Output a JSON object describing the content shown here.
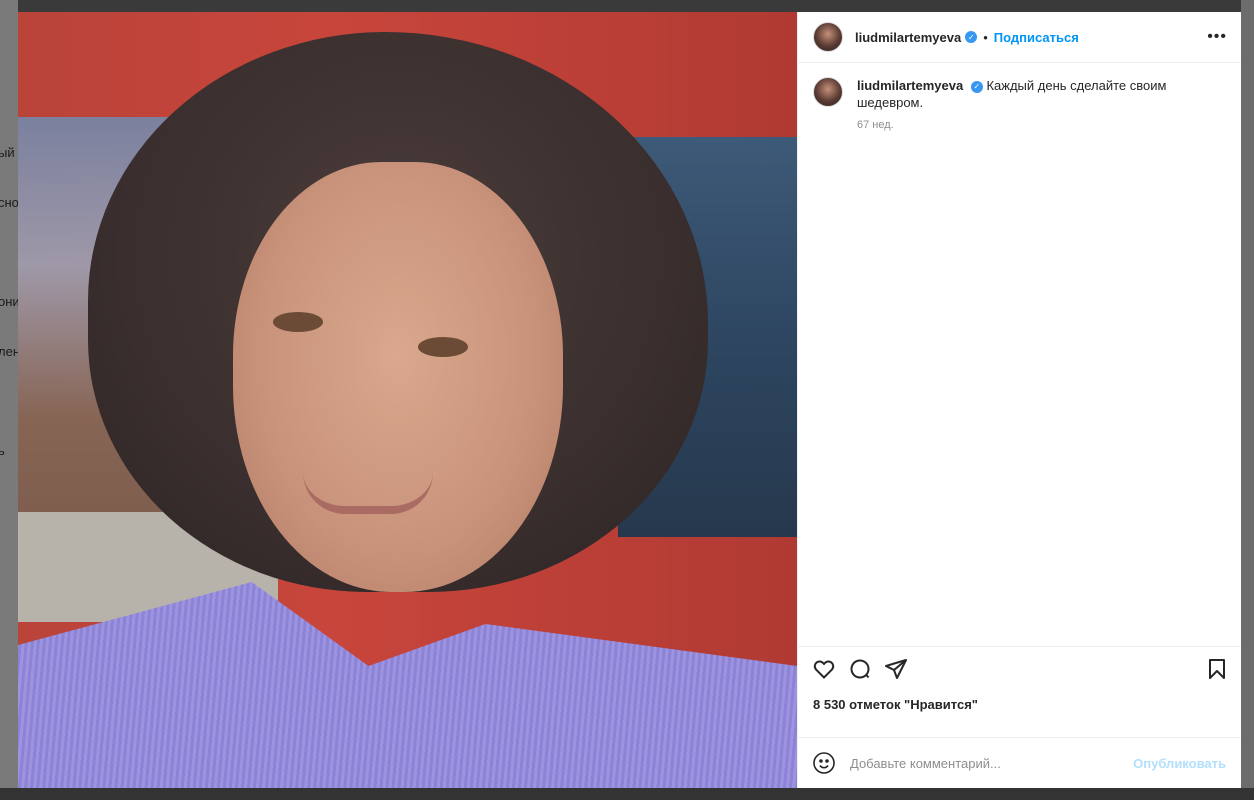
{
  "backdrop": {
    "nav_fragments": [
      "ый",
      "сно",
      "они",
      "лен",
      "ь"
    ]
  },
  "post": {
    "username": "liudmilartemyeva",
    "verified": true,
    "follow_label": "Подписаться",
    "more_label": "•••",
    "caption": {
      "username": "liudmilartemyeva",
      "text": "Каждый день сделайте своим шедевром.",
      "time": "67 нед."
    },
    "likes_text": "8 530 отметок \"Нравится\"",
    "comment": {
      "placeholder": "Добавьте комментарий...",
      "publish_label": "Опубликовать"
    },
    "icons": {
      "like": "heart-icon",
      "comment": "comment-icon",
      "share": "send-icon",
      "save": "bookmark-icon",
      "emoji": "smiley-icon",
      "verified": "verified-badge-icon"
    },
    "colors": {
      "accent": "#0095f6",
      "verified": "#3897f0",
      "publish_disabled": "#b2dffc"
    }
  }
}
